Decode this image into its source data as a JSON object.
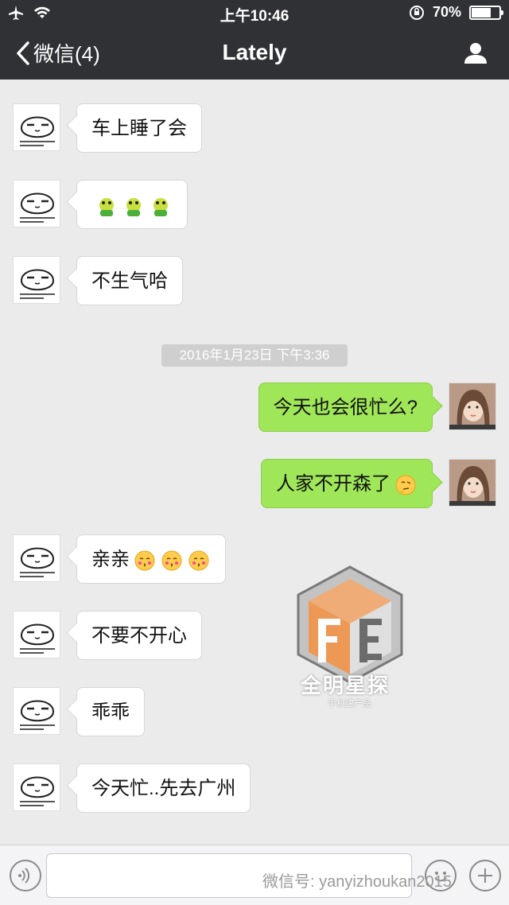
{
  "status_bar": {
    "time": "上午10:46",
    "battery_percent": "70%",
    "battery_level": 0.7
  },
  "nav": {
    "back_label": "微信(4)",
    "title": "Lately"
  },
  "messages": [
    {
      "side": "in",
      "text": "车上睡了会"
    },
    {
      "side": "in",
      "text": "",
      "emojis": [
        "frog",
        "frog",
        "frog"
      ]
    },
    {
      "side": "in",
      "text": "不生气哈"
    },
    {
      "side": "out",
      "text": "今天也会很忙么?"
    },
    {
      "side": "out",
      "text": "人家不开森了",
      "emojis": [
        "thinking"
      ]
    },
    {
      "side": "in",
      "text": "亲亲",
      "emojis": [
        "kiss",
        "kiss",
        "kiss"
      ]
    },
    {
      "side": "in",
      "text": "不要不开心"
    },
    {
      "side": "in",
      "text": "乖乖"
    },
    {
      "side": "in",
      "text": "今天忙..先去广州"
    }
  ],
  "timestamp": "2016年1月23日 下午3:36",
  "watermark": {
    "title": "全明星探",
    "subtitle": "手机速产品"
  },
  "footer_watermark": "微信号: yanyizhoukan2015",
  "colors": {
    "nav_bg": "#2f3135",
    "chat_bg": "#ebebeb",
    "outgoing_bubble": "#9fe658",
    "incoming_bubble": "#ffffff"
  }
}
